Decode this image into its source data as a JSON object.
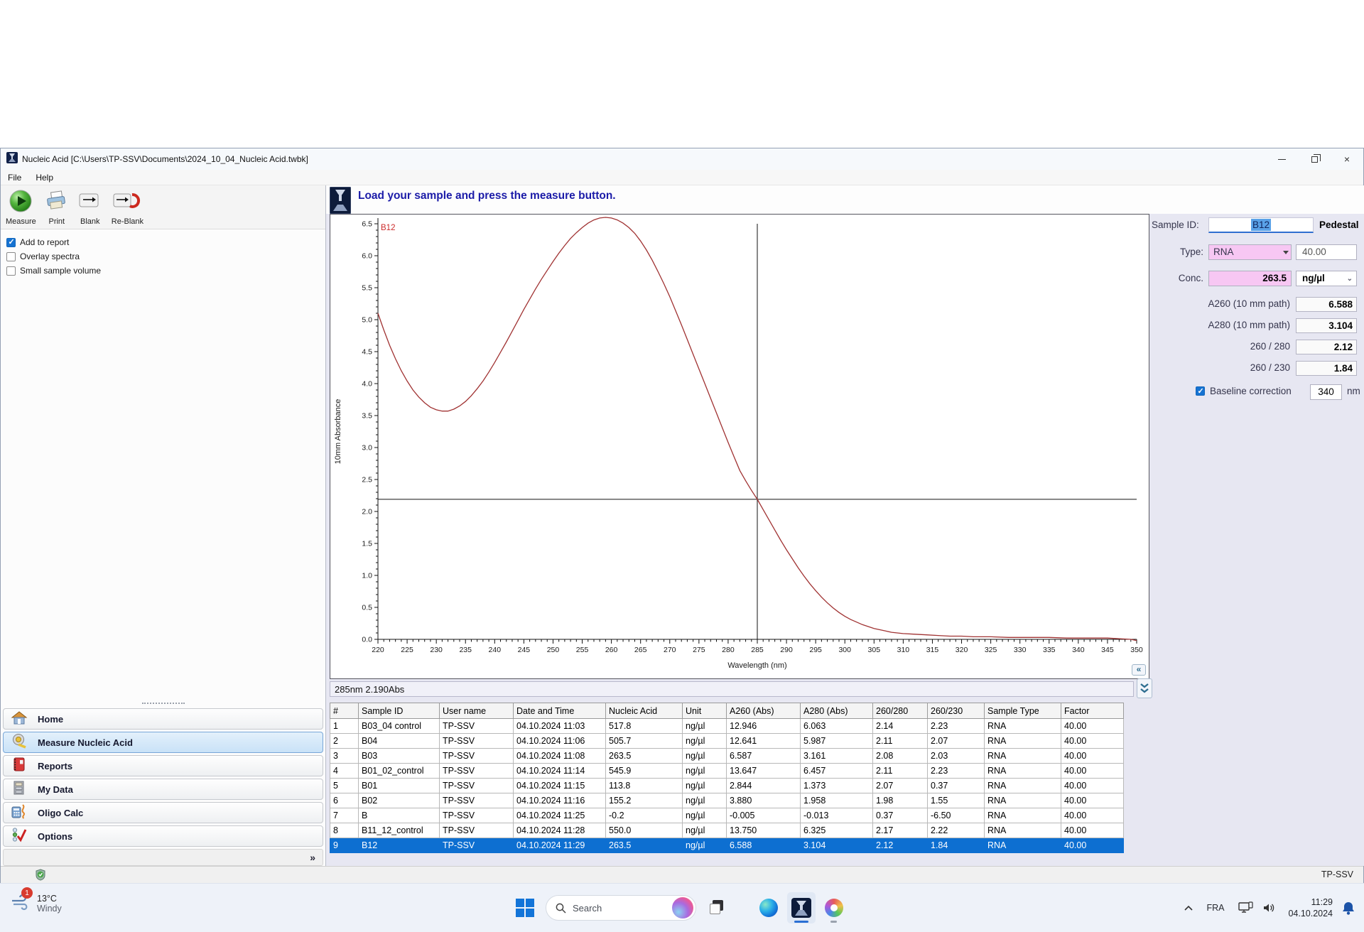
{
  "window": {
    "title": "Nucleic Acid  [C:\\Users\\TP-SSV\\Documents\\2024_10_04_Nucleic Acid.twbk]"
  },
  "menu": {
    "items": [
      {
        "label": "File"
      },
      {
        "label": "Help"
      }
    ]
  },
  "toolbar": {
    "buttons": [
      {
        "label": "Measure"
      },
      {
        "label": "Print"
      },
      {
        "label": "Blank"
      },
      {
        "label": "Re-Blank"
      }
    ]
  },
  "options": {
    "checkboxes": [
      {
        "label": "Add to report",
        "checked": true
      },
      {
        "label": "Overlay spectra",
        "checked": false
      },
      {
        "label": "Small sample volume",
        "checked": false
      }
    ]
  },
  "message_bar": {
    "text": "Load your sample and press the measure button."
  },
  "chart_data": {
    "type": "line",
    "series_label": "B12",
    "xlabel": "Wavelength (nm)",
    "ylabel": "10mm Absorbance",
    "xlim": [
      220,
      350
    ],
    "ylim": [
      0,
      6.5
    ],
    "x_tick_step": 5,
    "y_tick_step": 0.5,
    "line_color": "#a03232",
    "crosshair": {
      "x": 285,
      "y": 2.19
    },
    "points": [
      [
        220,
        5.1
      ],
      [
        221,
        4.84
      ],
      [
        222,
        4.6
      ],
      [
        223,
        4.39
      ],
      [
        224,
        4.2
      ],
      [
        225,
        4.04
      ],
      [
        226,
        3.9
      ],
      [
        227,
        3.79
      ],
      [
        228,
        3.7
      ],
      [
        229,
        3.63
      ],
      [
        230,
        3.59
      ],
      [
        231,
        3.57
      ],
      [
        232,
        3.57
      ],
      [
        233,
        3.6
      ],
      [
        234,
        3.65
      ],
      [
        235,
        3.72
      ],
      [
        236,
        3.81
      ],
      [
        237,
        3.92
      ],
      [
        238,
        4.04
      ],
      [
        239,
        4.18
      ],
      [
        240,
        4.33
      ],
      [
        241,
        4.49
      ],
      [
        242,
        4.65
      ],
      [
        243,
        4.82
      ],
      [
        244,
        4.99
      ],
      [
        245,
        5.16
      ],
      [
        246,
        5.32
      ],
      [
        247,
        5.48
      ],
      [
        248,
        5.63
      ],
      [
        249,
        5.77
      ],
      [
        250,
        5.91
      ],
      [
        251,
        6.04
      ],
      [
        252,
        6.16
      ],
      [
        253,
        6.27
      ],
      [
        254,
        6.36
      ],
      [
        255,
        6.44
      ],
      [
        256,
        6.51
      ],
      [
        257,
        6.56
      ],
      [
        258,
        6.59
      ],
      [
        259,
        6.6
      ],
      [
        260,
        6.59
      ],
      [
        261,
        6.56
      ],
      [
        262,
        6.51
      ],
      [
        263,
        6.44
      ],
      [
        264,
        6.35
      ],
      [
        265,
        6.23
      ],
      [
        266,
        6.09
      ],
      [
        267,
        5.93
      ],
      [
        268,
        5.75
      ],
      [
        269,
        5.56
      ],
      [
        270,
        5.36
      ],
      [
        271,
        5.14
      ],
      [
        272,
        4.92
      ],
      [
        273,
        4.69
      ],
      [
        274,
        4.46
      ],
      [
        275,
        4.23
      ],
      [
        276,
        4.0
      ],
      [
        277,
        3.77
      ],
      [
        278,
        3.54
      ],
      [
        279,
        3.31
      ],
      [
        280,
        3.08
      ],
      [
        281,
        2.86
      ],
      [
        282,
        2.64
      ],
      [
        283,
        2.48
      ],
      [
        284,
        2.33
      ],
      [
        285,
        2.19
      ],
      [
        286,
        2.03
      ],
      [
        287,
        1.87
      ],
      [
        288,
        1.71
      ],
      [
        289,
        1.55
      ],
      [
        290,
        1.4
      ],
      [
        291,
        1.26
      ],
      [
        292,
        1.12
      ],
      [
        293,
        0.99
      ],
      [
        294,
        0.87
      ],
      [
        295,
        0.76
      ],
      [
        296,
        0.66
      ],
      [
        297,
        0.57
      ],
      [
        298,
        0.49
      ],
      [
        299,
        0.42
      ],
      [
        300,
        0.36
      ],
      [
        301,
        0.31
      ],
      [
        302,
        0.27
      ],
      [
        303,
        0.23
      ],
      [
        304,
        0.2
      ],
      [
        305,
        0.17
      ],
      [
        306,
        0.15
      ],
      [
        307,
        0.13
      ],
      [
        308,
        0.11
      ],
      [
        309,
        0.1
      ],
      [
        310,
        0.09
      ],
      [
        312,
        0.08
      ],
      [
        314,
        0.07
      ],
      [
        316,
        0.06
      ],
      [
        318,
        0.05
      ],
      [
        320,
        0.05
      ],
      [
        322,
        0.04
      ],
      [
        325,
        0.04
      ],
      [
        328,
        0.03
      ],
      [
        330,
        0.03
      ],
      [
        333,
        0.03
      ],
      [
        335,
        0.03
      ],
      [
        338,
        0.02
      ],
      [
        340,
        0.02
      ],
      [
        343,
        0.02
      ],
      [
        345,
        0.02
      ],
      [
        347,
        0.01
      ],
      [
        349,
        0.0
      ],
      [
        350,
        -0.02
      ]
    ]
  },
  "status_strip": {
    "text": "285nm 2.190Abs"
  },
  "sample_panel": {
    "sample_id_label": "Sample ID:",
    "sample_id_value": "B12",
    "mode": "Pedestal",
    "type_label": "Type:",
    "type_value": "RNA",
    "factor_value": "40.00",
    "conc_label": "Conc.",
    "conc_value": "263.5",
    "conc_unit": "ng/µl",
    "rows": [
      {
        "label": "A260 (10 mm path)",
        "value": "6.588"
      },
      {
        "label": "A280 (10 mm path)",
        "value": "3.104"
      },
      {
        "label": "260 / 280",
        "value": "2.12"
      },
      {
        "label": "260 / 230",
        "value": "1.84"
      }
    ],
    "baseline_label": "Baseline correction",
    "baseline_checked": true,
    "baseline_value": "340",
    "baseline_unit": "nm"
  },
  "nav": {
    "items": [
      {
        "label": "Home",
        "selected": false
      },
      {
        "label": "Measure Nucleic Acid",
        "selected": true
      },
      {
        "label": "Reports",
        "selected": false
      },
      {
        "label": "My Data",
        "selected": false
      },
      {
        "label": "Oligo Calc",
        "selected": false
      },
      {
        "label": "Options",
        "selected": false
      }
    ],
    "collapse_glyph": "»"
  },
  "results_table": {
    "columns": [
      "#",
      "Sample ID",
      "User name",
      "Date and Time",
      "Nucleic Acid",
      "Unit",
      "A260 (Abs)",
      "A280 (Abs)",
      "260/280",
      "260/230",
      "Sample Type",
      "Factor"
    ],
    "selected_index": 8,
    "rows": [
      [
        "1",
        "B03_04 control",
        "TP-SSV",
        "04.10.2024 11:03",
        "517.8",
        "ng/µl",
        "12.946",
        "6.063",
        "2.14",
        "2.23",
        "RNA",
        "40.00"
      ],
      [
        "2",
        "B04",
        "TP-SSV",
        "04.10.2024 11:06",
        "505.7",
        "ng/µl",
        "12.641",
        "5.987",
        "2.11",
        "2.07",
        "RNA",
        "40.00"
      ],
      [
        "3",
        "B03",
        "TP-SSV",
        "04.10.2024 11:08",
        "263.5",
        "ng/µl",
        "6.587",
        "3.161",
        "2.08",
        "2.03",
        "RNA",
        "40.00"
      ],
      [
        "4",
        "B01_02_control",
        "TP-SSV",
        "04.10.2024 11:14",
        "545.9",
        "ng/µl",
        "13.647",
        "6.457",
        "2.11",
        "2.23",
        "RNA",
        "40.00"
      ],
      [
        "5",
        "B01",
        "TP-SSV",
        "04.10.2024 11:15",
        "113.8",
        "ng/µl",
        "2.844",
        "1.373",
        "2.07",
        "0.37",
        "RNA",
        "40.00"
      ],
      [
        "6",
        "B02",
        "TP-SSV",
        "04.10.2024 11:16",
        "155.2",
        "ng/µl",
        "3.880",
        "1.958",
        "1.98",
        "1.55",
        "RNA",
        "40.00"
      ],
      [
        "7",
        "B",
        "TP-SSV",
        "04.10.2024 11:25",
        "-0.2",
        "ng/µl",
        "-0.005",
        "-0.013",
        "0.37",
        "-6.50",
        "RNA",
        "40.00"
      ],
      [
        "8",
        "B11_12_control",
        "TP-SSV",
        "04.10.2024 11:28",
        "550.0",
        "ng/µl",
        "13.750",
        "6.325",
        "2.17",
        "2.22",
        "RNA",
        "40.00"
      ],
      [
        "9",
        "B12",
        "TP-SSV",
        "04.10.2024 11:29",
        "263.5",
        "ng/µl",
        "6.588",
        "3.104",
        "2.12",
        "1.84",
        "RNA",
        "40.00"
      ]
    ]
  },
  "status_bar": {
    "user": "TP-SSV"
  },
  "taskbar": {
    "weather": {
      "temp": "13°C",
      "condition": "Windy",
      "badge": "1"
    },
    "search_placeholder": "Search",
    "tray": {
      "language": "FRA",
      "time": "11:29",
      "date": "04.10.2024"
    }
  }
}
